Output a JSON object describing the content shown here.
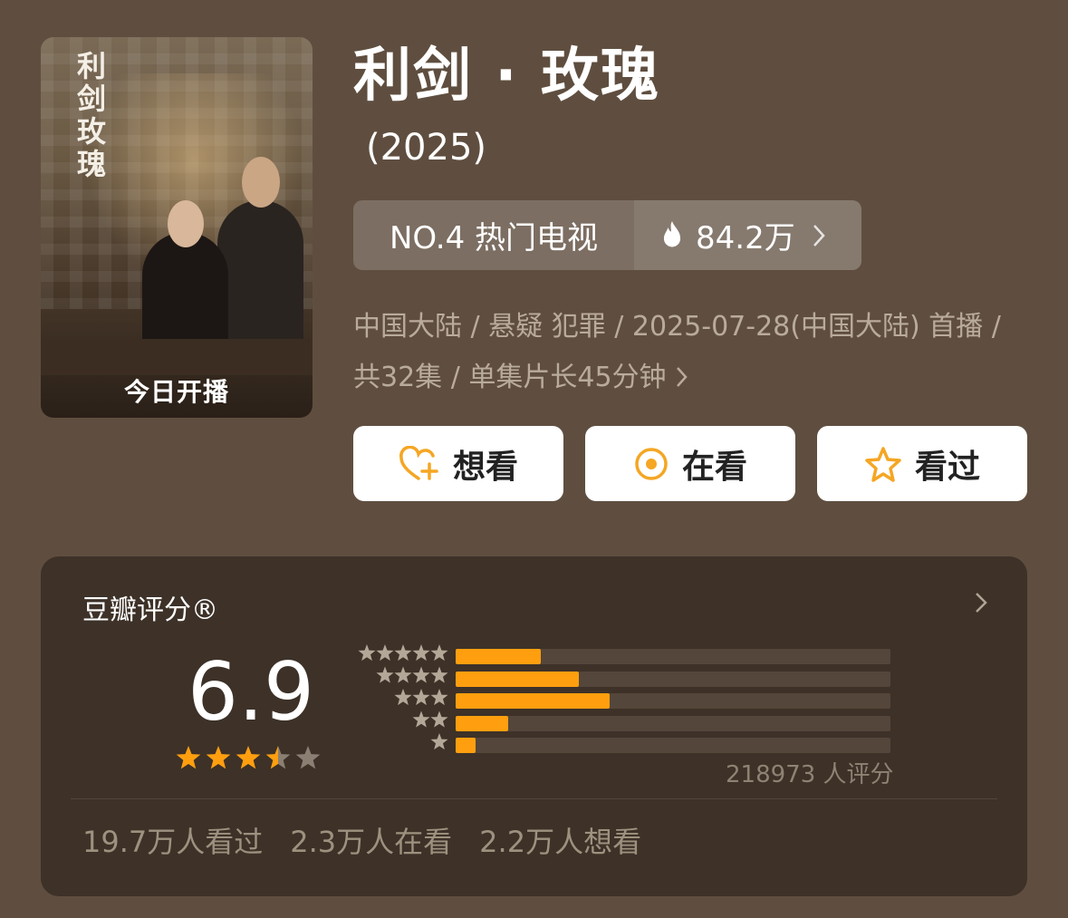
{
  "poster": {
    "title_lines": [
      "利剑",
      "玫瑰"
    ],
    "badge": "今日开播"
  },
  "header": {
    "title": "利剑 · 玫瑰",
    "year": "(2025)"
  },
  "rank": {
    "label": "NO.4 热门电视",
    "heat": "84.2万",
    "fire_icon": "fire-icon"
  },
  "meta": {
    "line": "中国大陆 / 悬疑 犯罪 / 2025-07-28(中国大陆) 首播 / 共32集 / 单集片长45分钟"
  },
  "actions": [
    {
      "label": "想看",
      "icon": "heart-plus-icon"
    },
    {
      "label": "在看",
      "icon": "target-icon"
    },
    {
      "label": "看过",
      "icon": "star-outline-icon"
    }
  ],
  "colors": {
    "accent": "#ff9f0f",
    "panel": "#3d3128",
    "background": "#5f4e3f"
  },
  "rating": {
    "title": "豆瓣评分®",
    "score": "6.9",
    "stars_value": 3.5,
    "count_text": "218973 人评分",
    "distribution": [
      {
        "stars": 5,
        "fraction": 0.195
      },
      {
        "stars": 4,
        "fraction": 0.283
      },
      {
        "stars": 3,
        "fraction": 0.355
      },
      {
        "stars": 2,
        "fraction": 0.12
      },
      {
        "stars": 1,
        "fraction": 0.045
      }
    ]
  },
  "stats": [
    "19.7万人看过",
    "2.3万人在看",
    "2.2万人想看"
  ]
}
